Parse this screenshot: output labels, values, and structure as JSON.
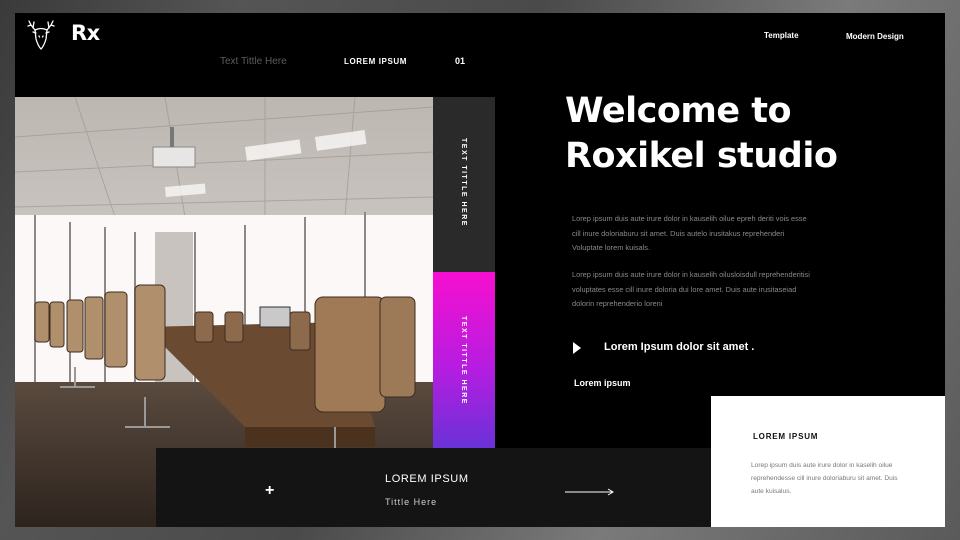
{
  "header": {
    "brand": "Rx",
    "logo_icon": "deer-head-icon",
    "nav": [
      "Template",
      "Modern Design"
    ],
    "sub_title": "Text Tittle Here",
    "sub_label": "LOREM IPSUM",
    "page_number": "01"
  },
  "photo": {
    "icon": "conference-room-photo"
  },
  "side_strip": {
    "label_top": "TEXT TITTLE HERE",
    "label_bottom": "TEXT TITTLE HERE",
    "colors": {
      "dark": "#2a2a2a",
      "gradient_start": "#f70fd0",
      "gradient_end": "#6a32d8"
    }
  },
  "main": {
    "headline_line1": "Welcome to",
    "headline_line2": "Roxikel studio",
    "paragraph1": "Lorep ipsum duis aute irure dolor in kauselih oilue epreh deriti vois esse cill inure doloriaburu sit amet. Duis autelo irusitakus reprehenderi Voluptate lorem kuisals.",
    "paragraph2": "Lorep ipsum duis aute irure dolor in kauselih oilusloisdull reprehenderitisi voluptates esse cill inure doloria dui lore amet. Duis aute irusitaseiad dolorin reprehenderio loreni",
    "bullet_icon": "play-triangle-icon",
    "bullet_text": "Lorem Ipsum dolor sit amet .",
    "small_label": "Lorem ipsum"
  },
  "bottom_bar": {
    "plus_icon": "plus-icon",
    "title": "LOREM IPSUM",
    "subtitle": "Tittle Here",
    "arrow_icon": "arrow-right-icon"
  },
  "card": {
    "title": "LOREM IPSUM",
    "text": "Lorep ipsum duis aute irure dolor in kaselih oilue reprehendesse cill inure doloriaburu sit amet. Duis aute kuisalus."
  }
}
